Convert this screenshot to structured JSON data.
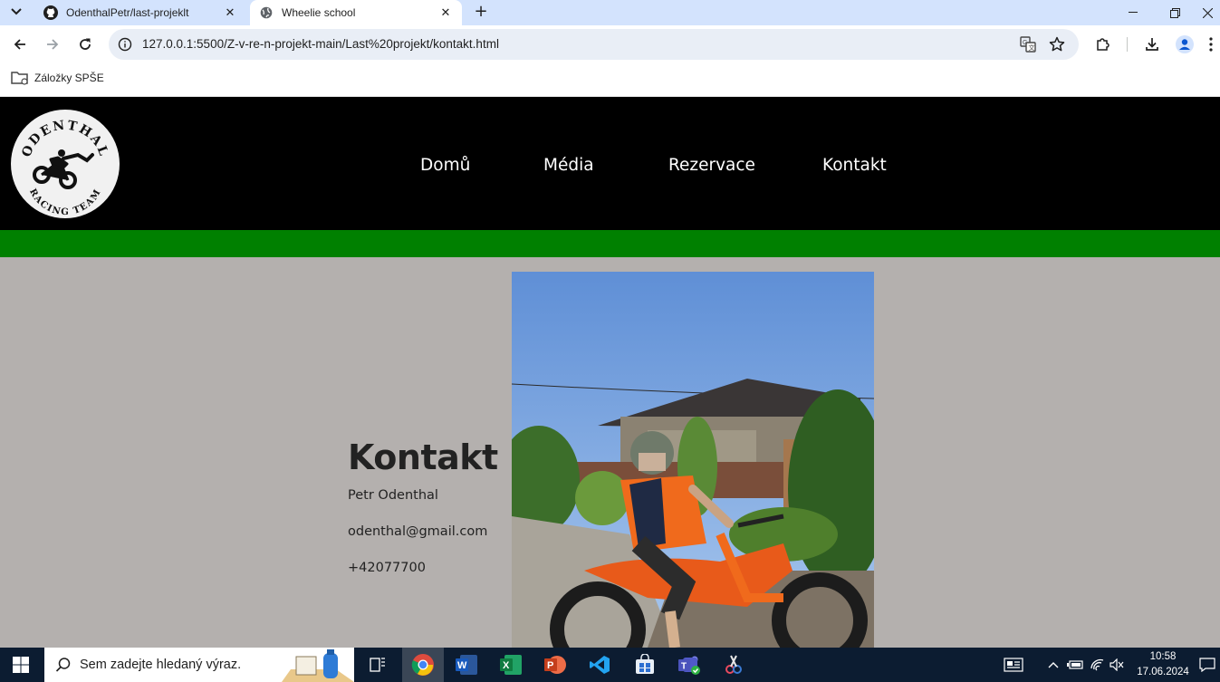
{
  "browser": {
    "tabs": [
      {
        "title": "OdenthalPetr/last-projeklt",
        "active": false,
        "icon": "github-icon"
      },
      {
        "title": "Wheelie school",
        "active": true,
        "icon": "globe-icon"
      }
    ],
    "url": "127.0.0.1:5500/Z-v-re-n-projekt-main/Last%20projekt/kontakt.html",
    "bookmarks": [
      {
        "label": "Záložky SPŠE",
        "icon": "folder-icon"
      }
    ]
  },
  "site": {
    "logo_text_top": "ODENTHAL",
    "logo_text_bottom": "RACING TEAM",
    "nav": [
      {
        "label": "Domů"
      },
      {
        "label": "Média"
      },
      {
        "label": "Rezervace"
      },
      {
        "label": "Kontakt"
      }
    ],
    "colors": {
      "header": "#000000",
      "accent_bar": "#008000",
      "background": "#b4b0ae"
    },
    "contact": {
      "heading": "Kontakt",
      "name": "Petr Odenthal",
      "email": "odenthal@gmail.com",
      "phone": "+42077700"
    }
  },
  "taskbar": {
    "search_placeholder": "Sem zadejte hledaný výraz.",
    "apps": [
      "task-view-icon",
      "chrome-icon",
      "word-icon",
      "excel-icon",
      "powerpoint-icon",
      "vscode-icon",
      "store-icon",
      "teams-icon",
      "snip-icon"
    ],
    "time": "10:58",
    "date": "17.06.2024"
  }
}
